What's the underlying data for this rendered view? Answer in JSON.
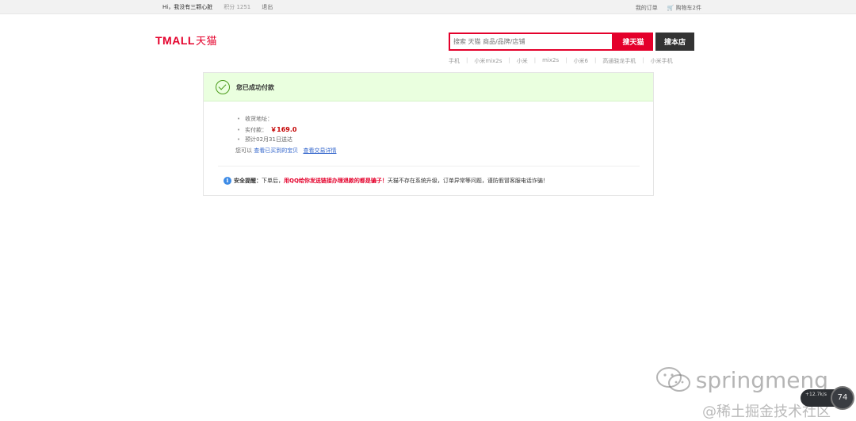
{
  "topbar": {
    "greeting": "Hi，我没有三颗心脏",
    "points": "积分 1251",
    "logout": "退出",
    "my_orders": "我的订单",
    "cart": "购物车2件"
  },
  "logo": {
    "latin": "TMALL",
    "cn": "天猫"
  },
  "search": {
    "placeholder": "搜索 天猫 商品/品牌/店铺",
    "search_tmall": "搜天猫",
    "search_store": "搜本店"
  },
  "hot_words": [
    "手机",
    "小米mix2s",
    "小米",
    "mix2s",
    "小米6",
    "高通骁龙手机",
    "小米手机"
  ],
  "result": {
    "title": "您已成功付款",
    "address_label": "收货地址：",
    "paid_label": "实付款：",
    "paid_value": "￥169.0",
    "delivery": "预计02月31日送达",
    "links_prefix": "您可以",
    "link_bought": "查看已买到的宝贝",
    "link_trade": "查看交易详情"
  },
  "warning": {
    "label": "安全提醒：",
    "part1": "下单后，",
    "highlight": "用QQ给你发送链接办理退款的都是骗子！",
    "part2": "天猫不存在系统升级，订单异常等问题，谨防假冒客服电话诈骗！"
  },
  "watermark": {
    "name": "springmeng",
    "site": "@稀土掘金技术社区"
  },
  "float_widget": {
    "speed": "+12.7k/s",
    "value": "74"
  },
  "colors": {
    "brand_red": "#e4002b",
    "success_bg": "#eaffdf",
    "success_green": "#4b9b1a",
    "link_blue": "#3366cc"
  }
}
